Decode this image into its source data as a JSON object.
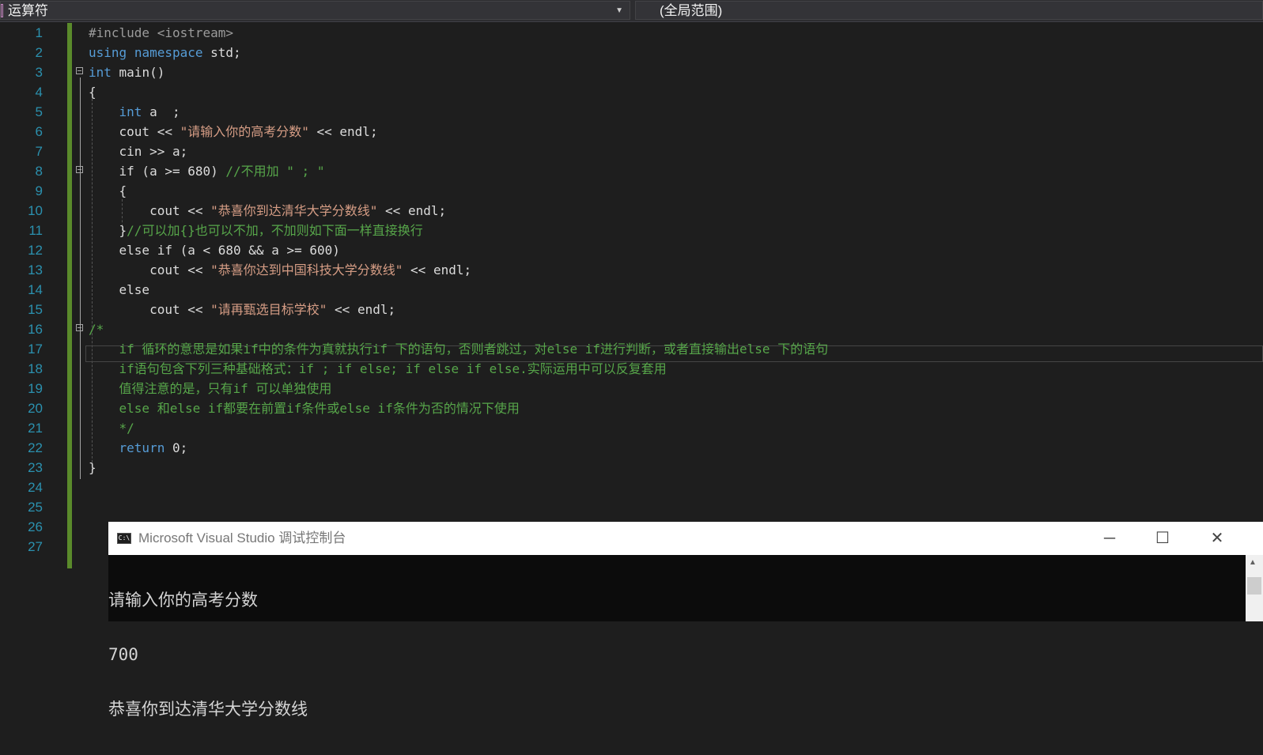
{
  "navbar": {
    "left_dropdown": "运算符",
    "right_dropdown": "(全局范围)"
  },
  "editor": {
    "lines": [
      {
        "n": "1",
        "text": "#include <iostream>"
      },
      {
        "n": "2",
        "text": "using namespace std;"
      },
      {
        "n": "3",
        "text": "int main()"
      },
      {
        "n": "4",
        "text": "{"
      },
      {
        "n": "5",
        "text": "    int a  ;"
      },
      {
        "n": "6",
        "text": "    cout << \"请输入你的高考分数\" << endl;"
      },
      {
        "n": "7",
        "text": "    cin >> a;"
      },
      {
        "n": "8",
        "text": "    if (a >= 680) //不用加 \" ; \""
      },
      {
        "n": "9",
        "text": "    {"
      },
      {
        "n": "10",
        "text": "        cout << \"恭喜你到达清华大学分数线\" << endl;"
      },
      {
        "n": "11",
        "text": "    }//可以加{}也可以不加，不加则如下面一样直接换行"
      },
      {
        "n": "12",
        "text": "    else if (a < 680 && a >= 600)"
      },
      {
        "n": "13",
        "text": "        cout << \"恭喜你达到中国科技大学分数线\" << endl;"
      },
      {
        "n": "14",
        "text": "    else"
      },
      {
        "n": "15",
        "text": "        cout << \"请再甄选目标学校\" << endl;"
      },
      {
        "n": "16",
        "text": "/*"
      },
      {
        "n": "17",
        "text": "    if 循环的意思是如果if中的条件为真就执行if 下的语句，否则者跳过，对else if进行判断，或者直接输出else 下的语句"
      },
      {
        "n": "18",
        "text": "    if语句包含下列三种基础格式：if ; if else; if else if else.实际运用中可以反复套用"
      },
      {
        "n": "19",
        "text": "    值得注意的是，只有if 可以单独使用"
      },
      {
        "n": "20",
        "text": "    else 和else if都要在前置if条件或else if条件为否的情况下使用"
      },
      {
        "n": "21",
        "text": "    */"
      },
      {
        "n": "22",
        "text": "    return 0;"
      },
      {
        "n": "23",
        "text": "}"
      },
      {
        "n": "24",
        "text": ""
      },
      {
        "n": "25",
        "text": ""
      },
      {
        "n": "26",
        "text": ""
      },
      {
        "n": "27",
        "text": ""
      }
    ]
  },
  "console": {
    "title": "Microsoft Visual Studio 调试控制台",
    "icon_text": "C:\\",
    "output": [
      "请输入你的高考分数",
      "700",
      "恭喜你到达清华大学分数线"
    ]
  },
  "colors": {
    "keyword": "#569cd6",
    "string": "#d69d85",
    "comment": "#57a64a",
    "line_number": "#2b91af"
  }
}
